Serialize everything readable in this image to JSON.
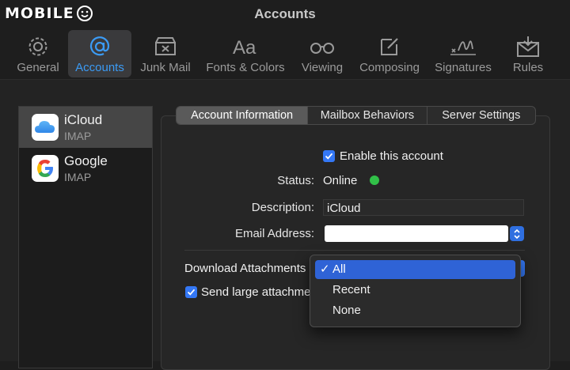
{
  "watermark": {
    "text": "MOBILE"
  },
  "window": {
    "title": "Accounts"
  },
  "toolbar": {
    "items": [
      {
        "label": "General",
        "icon": "gear-icon"
      },
      {
        "label": "Accounts",
        "icon": "at-sign-icon",
        "active": true
      },
      {
        "label": "Junk Mail",
        "icon": "junk-tray-icon"
      },
      {
        "label": "Fonts & Colors",
        "icon": "fonts-aa-icon"
      },
      {
        "label": "Viewing",
        "icon": "glasses-icon"
      },
      {
        "label": "Composing",
        "icon": "compose-icon"
      },
      {
        "label": "Signatures",
        "icon": "signature-icon"
      },
      {
        "label": "Rules",
        "icon": "rules-envelope-icon"
      }
    ]
  },
  "accounts": [
    {
      "name": "iCloud",
      "type": "IMAP",
      "icon": "icloud-icon",
      "selected": true
    },
    {
      "name": "Google",
      "type": "IMAP",
      "icon": "google-icon"
    }
  ],
  "tabs": [
    {
      "label": "Account Information",
      "active": true
    },
    {
      "label": "Mailbox Behaviors"
    },
    {
      "label": "Server Settings"
    }
  ],
  "form": {
    "enable_label": "Enable this account",
    "status_label": "Status:",
    "status_value": "Online",
    "description_label": "Description:",
    "description_value": "iCloud",
    "email_label": "Email Address:",
    "email_value": "",
    "download_label": "Download Attachments",
    "send_large_label": "Send large attachme"
  },
  "dropdown": {
    "options": [
      {
        "label": "All",
        "selected": true
      },
      {
        "label": "Recent"
      },
      {
        "label": "None"
      }
    ]
  },
  "colors": {
    "accent": "#3478f6",
    "active_tab_icon": "#3b9bf5",
    "status_online": "#31c048"
  }
}
